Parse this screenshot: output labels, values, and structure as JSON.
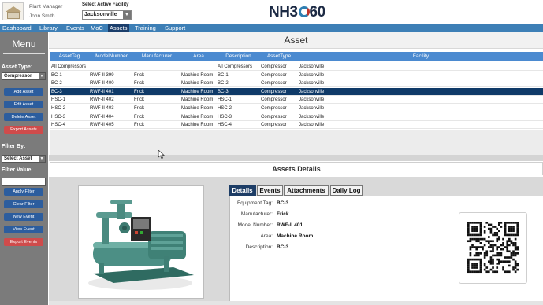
{
  "header": {
    "role": "Plant Manager",
    "user_name": "John Smith",
    "facility_label": "Select Active Facility",
    "facility_value": "Jacksonville",
    "brand_prefix": "NH3",
    "brand_suffix": "60"
  },
  "nav": {
    "items": [
      "Dashboard",
      "Library",
      "Events",
      "MoC",
      "Assets",
      "Training",
      "Support"
    ],
    "active": "Assets"
  },
  "sidebar": {
    "title": "Menu",
    "asset_type_label": "Asset Type:",
    "asset_type_value": "Compressor",
    "buttons_top": [
      "Add Asset",
      "Edit Asset",
      "Delete Asset",
      "Export Assets"
    ],
    "filter_by_label": "Filter By:",
    "filter_by_value": "Select Asset",
    "filter_value_label": "Filter Value:",
    "filter_value": "",
    "buttons_bottom": [
      "Apply Filter",
      "Clear Filter",
      "New Event",
      "View Event",
      "Export Events"
    ]
  },
  "assets": {
    "title": "Asset",
    "columns": [
      "AssetTag",
      "ModelNumber",
      "Manufacturer",
      "Area",
      "Description",
      "AssetType",
      "Facility"
    ],
    "rows": [
      [
        "All Compressors",
        "",
        "",
        "",
        "All Compressors",
        "Compressor",
        "Jacksonville"
      ],
      [
        "BC-1",
        "RWF-II 399",
        "Frick",
        "Machine Room",
        "BC-1",
        "Compressor",
        "Jacksonville"
      ],
      [
        "BC-2",
        "RWF-II 400",
        "Frick",
        "Machine Room",
        "BC-2",
        "Compressor",
        "Jacksonville"
      ],
      [
        "BC-3",
        "RWF-II 401",
        "Frick",
        "Machine Room",
        "BC-3",
        "Compressor",
        "Jacksonville"
      ],
      [
        "HSC-1",
        "RWF-II 402",
        "Frick",
        "Machine Room",
        "HSC-1",
        "Compressor",
        "Jacksonville"
      ],
      [
        "HSC-2",
        "RWF-II 403",
        "Frick",
        "Machine Room",
        "HSC-2",
        "Compressor",
        "Jacksonville"
      ],
      [
        "HSC-3",
        "RWF-II 404",
        "Frick",
        "Machine Room",
        "HSC-3",
        "Compressor",
        "Jacksonville"
      ],
      [
        "HSC-4",
        "RWF-II 405",
        "Frick",
        "Machine Room",
        "HSC-4",
        "Compressor",
        "Jacksonville"
      ]
    ],
    "selected_row": 3
  },
  "details": {
    "title": "Assets Details",
    "tabs": [
      "Details",
      "Events",
      "Attachments",
      "Daily Log"
    ],
    "active_tab": "Details",
    "fields": [
      {
        "label": "Equipment Tag:",
        "value": "BC-3"
      },
      {
        "label": "Manufacturer:",
        "value": "Frick"
      },
      {
        "label": "Model Number:",
        "value": "RWF-II 401"
      },
      {
        "label": "Area:",
        "value": "Machine Room"
      },
      {
        "label": "Description:",
        "value": "BC-3"
      }
    ]
  },
  "colors": {
    "nav_bg": "#3d7fb6",
    "nav_active": "#1b3e6b",
    "sidebar_bg": "#7b7b7b",
    "table_header": "#4b8ad0",
    "selected_row": "#0f3a68",
    "button_blue": "#2c5d9e",
    "button_red": "#cf4b4b"
  }
}
